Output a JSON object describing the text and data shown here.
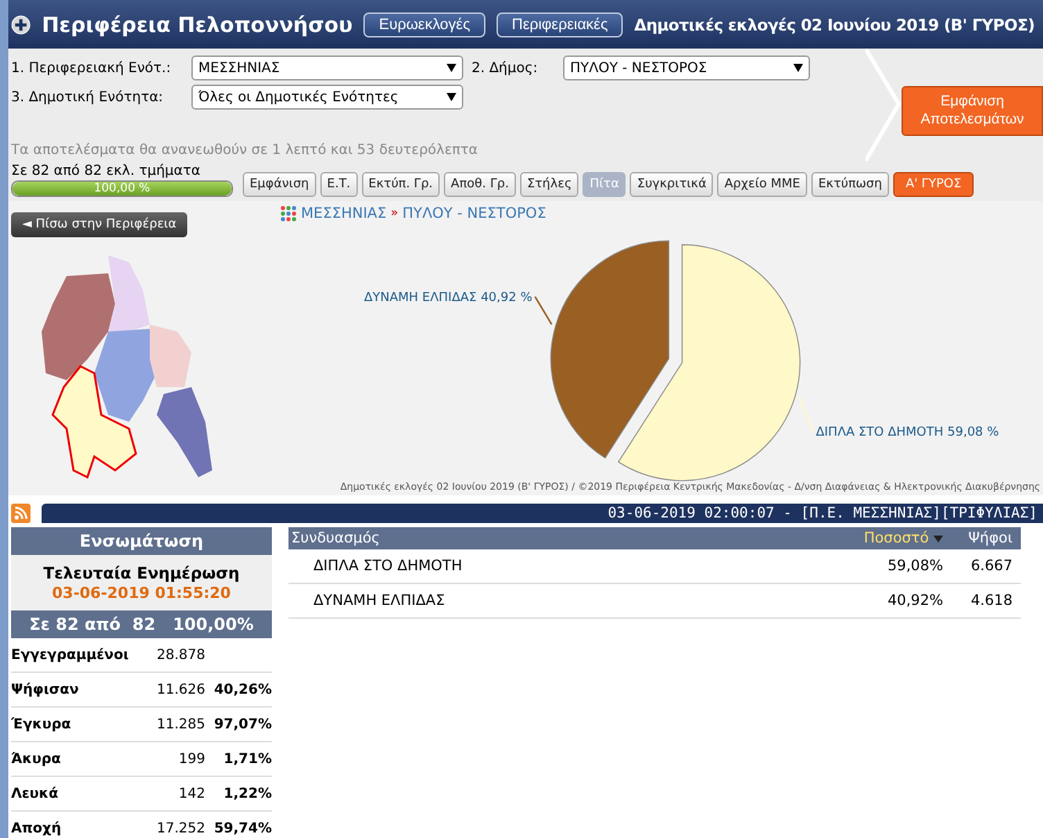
{
  "header": {
    "title": "Περιφέρεια Πελοποννήσου",
    "links": [
      "Ευρωεκλογές",
      "Περιφερειακές"
    ],
    "election": "Δημοτικές εκλογές 02 Ιουνίου 2019 (Β' ΓΥΡΟΣ)"
  },
  "filters": [
    {
      "label": "1. Περιφερειακή Ενότ.:",
      "value": "ΜΕΣΣΗΝΙΑΣ"
    },
    {
      "label": "2. Δήμος:",
      "value": "ΠΥΛΟΥ - ΝΕΣΤΟΡΟΣ"
    },
    {
      "label": "3. Δημοτική Ενότητα:",
      "value": "Όλες οι Δημοτικές Ενότητες"
    }
  ],
  "show_button": "Εμφάνιση Αποτελεσμάτων",
  "refresh_note": "Τα αποτελέσματα θα ανανεωθούν σε 1 λεπτό και 53 δευτερόλεπτα",
  "progress": {
    "label": "Σε 82 από 82 εκλ. τμήματα",
    "reading": "100,00 %",
    "level": 1
  },
  "toolbar": [
    {
      "label": "Εμφάνιση",
      "kind": "plain",
      "selected": false
    },
    {
      "label": "Ε.Τ.",
      "kind": "plain",
      "selected": false
    },
    {
      "label": "Εκτύπ. Γρ.",
      "kind": "plain",
      "selected": false
    },
    {
      "label": "Αποθ. Γρ.",
      "kind": "plain",
      "selected": false
    },
    {
      "label": "Στήλες",
      "kind": "plain",
      "selected": false
    },
    {
      "label": "Πίτα",
      "kind": "plain",
      "selected": true
    },
    {
      "label": "Συγκριτικά",
      "kind": "plain",
      "selected": false
    },
    {
      "label": "Αρχείο ΜΜΕ",
      "kind": "plain",
      "selected": false
    },
    {
      "label": "Εκτύπωση",
      "kind": "plain",
      "selected": false
    },
    {
      "label": "Α' ΓΥΡΟΣ",
      "kind": "accent",
      "selected": false
    }
  ],
  "back_button": "◄ Πίσω στην Περιφέρεια",
  "breadcrumb": [
    "ΜΕΣΣΗΝΙΑΣ",
    "ΠΥΛΟΥ - ΝΕΣΤΟΡΟΣ"
  ],
  "breadcrumb_separator": "»",
  "chart_data": {
    "type": "pie",
    "categories": [
      "ΔΙΠΛΑ ΣΤΟ ΔΗΜΟΤΗ",
      "ΔΥΝΑΜΗ ΕΛΠΙΔΑΣ"
    ],
    "values": [
      59.08,
      40.92
    ],
    "colors": [
      "#fff8c8",
      "#9a5f22"
    ],
    "value_labels": [
      "59,08 %",
      "40,92 %"
    ]
  },
  "chart_credit": "Δημοτικές εκλογές 02 Ιουνίου 2019 (Β' ΓΥΡΟΣ) / ©2019 Περιφέρεια Κεντρικής Μακεδονίας - Δ/νση Διαφάνειας & Ηλεκτρονικής Διακυβέρνησης",
  "ticker": "03-06-2019 02:00:07 - [Π.Ε. ΜΕΣΣΗΝΙΑΣ][ΤΡΙΦΥΛΙΑΣ]",
  "summary": {
    "title": "Ενσωμάτωση",
    "update_label": "Τελευταία Ενημέρωση",
    "update_time": "03-06-2019 01:55:20",
    "coverage": "Σε 82 από  82   100,00%",
    "rows": [
      {
        "label": "Εγγεγραμμένοι",
        "count": "28.878"
      },
      {
        "label": "Ψήφισαν",
        "count": "11.626",
        "percent": "40,26%"
      },
      {
        "label": "Έγκυρα",
        "count": "11.285",
        "percent": "97,07%"
      },
      {
        "label": "Άκυρα",
        "count": "199",
        "percent": "1,71%"
      },
      {
        "label": "Λευκά",
        "count": "142",
        "percent": "1,22%"
      },
      {
        "label": "Αποχή",
        "count": "17.252",
        "percent": "59,74%"
      }
    ]
  },
  "results": {
    "columns": [
      {
        "label": "Συνδυασμός",
        "sorted": false
      },
      {
        "label": "Ποσοστό",
        "sorted": true
      },
      {
        "label": "Ψήφοι",
        "sorted": false
      }
    ],
    "rows": [
      [
        "ΔΙΠΛΑ ΣΤΟ ΔΗΜΟΤΗ",
        "59,08%",
        "6.667"
      ],
      [
        "ΔΥΝΑΜΗ ΕΛΠΙΔΑΣ",
        "40,92%",
        "4.618"
      ]
    ]
  }
}
